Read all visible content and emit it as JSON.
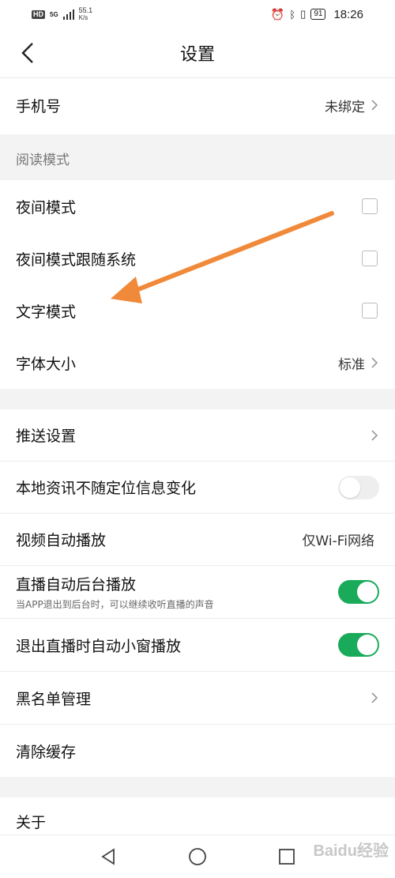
{
  "status_bar": {
    "hd": "HD",
    "net_gen": "5G",
    "speed": "55.1",
    "speed_unit": "K/s",
    "battery": "91",
    "time": "18:26"
  },
  "header": {
    "title": "设置"
  },
  "phone": {
    "label": "手机号",
    "value": "未绑定"
  },
  "reading_section": {
    "title": "阅读模式",
    "items": [
      {
        "label": "夜间模式",
        "checked": false
      },
      {
        "label": "夜间模式跟随系统",
        "checked": false
      },
      {
        "label": "文字模式",
        "checked": false
      }
    ],
    "font_size": {
      "label": "字体大小",
      "value": "标准"
    }
  },
  "general_section": {
    "push": {
      "label": "推送设置"
    },
    "local_news": {
      "label": "本地资讯不随定位信息变化",
      "on": false
    },
    "video_autoplay": {
      "label": "视频自动播放",
      "value": "仅Wi-Fi网络"
    },
    "live_background": {
      "label": "直播自动后台播放",
      "sub": "当APP退出到后台时，可以继续收听直播的声音",
      "on": true
    },
    "live_miniwindow": {
      "label": "退出直播时自动小窗播放",
      "on": true
    },
    "blacklist": {
      "label": "黑名单管理"
    },
    "clear_cache": {
      "label": "清除缓存"
    }
  },
  "about": {
    "label": "关于"
  },
  "colors": {
    "accent_green": "#1aab5a",
    "arrow_orange": "#f08a3a"
  },
  "watermark": "Baidu经验"
}
